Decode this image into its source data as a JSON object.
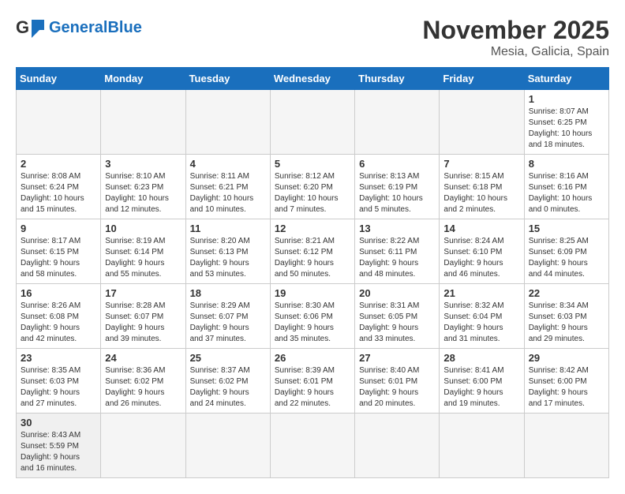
{
  "header": {
    "logo_general": "General",
    "logo_blue": "Blue",
    "month_title": "November 2025",
    "subtitle": "Mesia, Galicia, Spain"
  },
  "days_of_week": [
    "Sunday",
    "Monday",
    "Tuesday",
    "Wednesday",
    "Thursday",
    "Friday",
    "Saturday"
  ],
  "weeks": [
    [
      {
        "num": "",
        "info": ""
      },
      {
        "num": "",
        "info": ""
      },
      {
        "num": "",
        "info": ""
      },
      {
        "num": "",
        "info": ""
      },
      {
        "num": "",
        "info": ""
      },
      {
        "num": "",
        "info": ""
      },
      {
        "num": "1",
        "info": "Sunrise: 8:07 AM\nSunset: 6:25 PM\nDaylight: 10 hours\nand 18 minutes."
      }
    ],
    [
      {
        "num": "2",
        "info": "Sunrise: 8:08 AM\nSunset: 6:24 PM\nDaylight: 10 hours\nand 15 minutes."
      },
      {
        "num": "3",
        "info": "Sunrise: 8:10 AM\nSunset: 6:23 PM\nDaylight: 10 hours\nand 12 minutes."
      },
      {
        "num": "4",
        "info": "Sunrise: 8:11 AM\nSunset: 6:21 PM\nDaylight: 10 hours\nand 10 minutes."
      },
      {
        "num": "5",
        "info": "Sunrise: 8:12 AM\nSunset: 6:20 PM\nDaylight: 10 hours\nand 7 minutes."
      },
      {
        "num": "6",
        "info": "Sunrise: 8:13 AM\nSunset: 6:19 PM\nDaylight: 10 hours\nand 5 minutes."
      },
      {
        "num": "7",
        "info": "Sunrise: 8:15 AM\nSunset: 6:18 PM\nDaylight: 10 hours\nand 2 minutes."
      },
      {
        "num": "8",
        "info": "Sunrise: 8:16 AM\nSunset: 6:16 PM\nDaylight: 10 hours\nand 0 minutes."
      }
    ],
    [
      {
        "num": "9",
        "info": "Sunrise: 8:17 AM\nSunset: 6:15 PM\nDaylight: 9 hours\nand 58 minutes."
      },
      {
        "num": "10",
        "info": "Sunrise: 8:19 AM\nSunset: 6:14 PM\nDaylight: 9 hours\nand 55 minutes."
      },
      {
        "num": "11",
        "info": "Sunrise: 8:20 AM\nSunset: 6:13 PM\nDaylight: 9 hours\nand 53 minutes."
      },
      {
        "num": "12",
        "info": "Sunrise: 8:21 AM\nSunset: 6:12 PM\nDaylight: 9 hours\nand 50 minutes."
      },
      {
        "num": "13",
        "info": "Sunrise: 8:22 AM\nSunset: 6:11 PM\nDaylight: 9 hours\nand 48 minutes."
      },
      {
        "num": "14",
        "info": "Sunrise: 8:24 AM\nSunset: 6:10 PM\nDaylight: 9 hours\nand 46 minutes."
      },
      {
        "num": "15",
        "info": "Sunrise: 8:25 AM\nSunset: 6:09 PM\nDaylight: 9 hours\nand 44 minutes."
      }
    ],
    [
      {
        "num": "16",
        "info": "Sunrise: 8:26 AM\nSunset: 6:08 PM\nDaylight: 9 hours\nand 42 minutes."
      },
      {
        "num": "17",
        "info": "Sunrise: 8:28 AM\nSunset: 6:07 PM\nDaylight: 9 hours\nand 39 minutes."
      },
      {
        "num": "18",
        "info": "Sunrise: 8:29 AM\nSunset: 6:07 PM\nDaylight: 9 hours\nand 37 minutes."
      },
      {
        "num": "19",
        "info": "Sunrise: 8:30 AM\nSunset: 6:06 PM\nDaylight: 9 hours\nand 35 minutes."
      },
      {
        "num": "20",
        "info": "Sunrise: 8:31 AM\nSunset: 6:05 PM\nDaylight: 9 hours\nand 33 minutes."
      },
      {
        "num": "21",
        "info": "Sunrise: 8:32 AM\nSunset: 6:04 PM\nDaylight: 9 hours\nand 31 minutes."
      },
      {
        "num": "22",
        "info": "Sunrise: 8:34 AM\nSunset: 6:03 PM\nDaylight: 9 hours\nand 29 minutes."
      }
    ],
    [
      {
        "num": "23",
        "info": "Sunrise: 8:35 AM\nSunset: 6:03 PM\nDaylight: 9 hours\nand 27 minutes."
      },
      {
        "num": "24",
        "info": "Sunrise: 8:36 AM\nSunset: 6:02 PM\nDaylight: 9 hours\nand 26 minutes."
      },
      {
        "num": "25",
        "info": "Sunrise: 8:37 AM\nSunset: 6:02 PM\nDaylight: 9 hours\nand 24 minutes."
      },
      {
        "num": "26",
        "info": "Sunrise: 8:39 AM\nSunset: 6:01 PM\nDaylight: 9 hours\nand 22 minutes."
      },
      {
        "num": "27",
        "info": "Sunrise: 8:40 AM\nSunset: 6:01 PM\nDaylight: 9 hours\nand 20 minutes."
      },
      {
        "num": "28",
        "info": "Sunrise: 8:41 AM\nSunset: 6:00 PM\nDaylight: 9 hours\nand 19 minutes."
      },
      {
        "num": "29",
        "info": "Sunrise: 8:42 AM\nSunset: 6:00 PM\nDaylight: 9 hours\nand 17 minutes."
      }
    ],
    [
      {
        "num": "30",
        "info": "Sunrise: 8:43 AM\nSunset: 5:59 PM\nDaylight: 9 hours\nand 16 minutes."
      },
      {
        "num": "",
        "info": ""
      },
      {
        "num": "",
        "info": ""
      },
      {
        "num": "",
        "info": ""
      },
      {
        "num": "",
        "info": ""
      },
      {
        "num": "",
        "info": ""
      },
      {
        "num": "",
        "info": ""
      }
    ]
  ]
}
